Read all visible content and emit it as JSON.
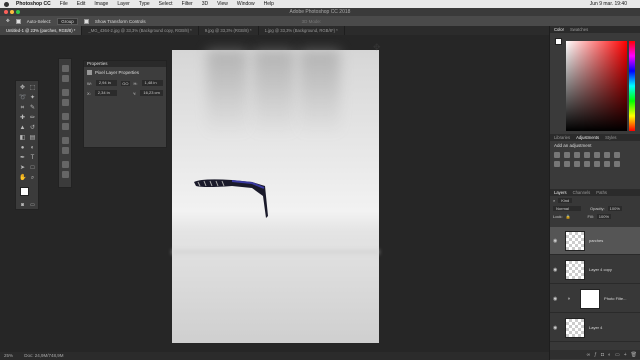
{
  "menubar": {
    "app": "Photoshop CC",
    "items": [
      "File",
      "Edit",
      "Image",
      "Layer",
      "Type",
      "Select",
      "Filter",
      "3D",
      "View",
      "Window",
      "Help"
    ],
    "clock": "Jun 9 mar. 19:40"
  },
  "window": {
    "title": "Adobe Photoshop CC 2018"
  },
  "options": {
    "auto_select": "Auto-Select:",
    "group": "Group",
    "transform": "Show Transform Controls",
    "mode": "3D Mode:"
  },
  "tabs": [
    "Untitled-1 @ 23% (parches, RGB/8) *",
    "_MG_4364-2.jpg @ 33,3% (Background copy, RGB/8) *",
    "9.jpg @ 33,3% (RGB/8) *",
    "1.jpg @ 33,3% (Background, RGB/8*) *"
  ],
  "properties": {
    "title": "Properties",
    "subtitle": "Pixel Layer Properties",
    "w_label": "W:",
    "w_value": "2,94 in",
    "h_label": "H:",
    "h_value": "1,48 in",
    "x_label": "X:",
    "x_value": "2,34 in",
    "y_label": "Y:",
    "y_value": "16,23 cm",
    "link": "GO"
  },
  "status": {
    "zoom": "25%",
    "doc": "Doc: 24,9M/748,9M"
  },
  "right_panels": {
    "color_tabs": [
      "Color",
      "Swatches"
    ],
    "adj_tabs": [
      "Libraries",
      "Adjustments",
      "Styles"
    ],
    "adj_heading": "Add an adjustment",
    "layer_tabs": [
      "Layers",
      "Channels",
      "Paths"
    ],
    "kind": "Kind",
    "blend": "Normal",
    "opacity_label": "Opacity:",
    "opacity": "100%",
    "lock_label": "Lock:",
    "fill_label": "Fill:",
    "fill": "100%"
  },
  "layers": [
    {
      "name": "parches"
    },
    {
      "name": "Layer 4 copy"
    },
    {
      "name": "Photo Filte..."
    },
    {
      "name": "Layer 4"
    }
  ]
}
